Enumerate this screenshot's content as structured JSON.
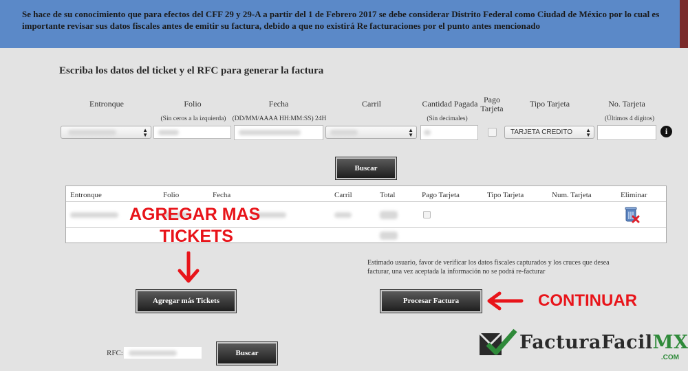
{
  "banner": {
    "text": "Se hace de su conocimiento que para efectos del CFF 29 y 29-A a partir del 1 de Febrero 2017 se debe considerar Distrito Federal como Ciudad de México por lo cual es importante revisar sus datos fiscales antes de emitir su factura, debido a que no existirá Re facturaciones por el punto antes mencionado"
  },
  "form": {
    "title": "Escriba los datos del ticket y el RFC para generar la factura",
    "headers": {
      "entronque": "Entronque",
      "folio": "Folio",
      "fecha": "Fecha",
      "carril": "Carril",
      "cantidad": "Cantidad Pagada",
      "pago_line1": "Pago",
      "pago_line2": "Tarjeta",
      "tipo": "Tipo Tarjeta",
      "no_tarjeta": "No. Tarjeta"
    },
    "hints": {
      "folio": "(Sin ceros a la izquierda)",
      "fecha": "(DD/MM/AAAA HH:MM:SS) 24H",
      "cantidad": "(Sin decimales)",
      "no_tarjeta": "(Últimos 4 dígitos)"
    },
    "tipo_tarjeta_value": "TARJETA CREDITO",
    "info_icon_glyph": "i",
    "search_button": "Buscar"
  },
  "table": {
    "headers": [
      "Entronque",
      "Folio",
      "Fecha",
      "Carril",
      "Total",
      "Pago Tarjeta",
      "Tipo Tarjeta",
      "Num. Tarjeta",
      "Eliminar"
    ]
  },
  "callouts": {
    "agregar_line1": "AGREGAR MAS",
    "agregar_line2": "TICKETS",
    "continuar": "CONTINUAR"
  },
  "note": "Estimado usuario, favor de verificar los datos fiscales capturados y los cruces que desea facturar, una vez aceptada la información no se podrá re-facturar",
  "buttons": {
    "agregar": "Agregar más Tickets",
    "procesar": "Procesar Factura",
    "rfc_buscar": "Buscar"
  },
  "rfc": {
    "label": "RFC:"
  },
  "logo": {
    "word": "FacturaFacil",
    "mx": "MX",
    "dotcom": ".COM"
  },
  "colors": {
    "banner": "#5b89c8",
    "callout_red": "#e8141a",
    "logo_green": "#2f8a3a"
  }
}
